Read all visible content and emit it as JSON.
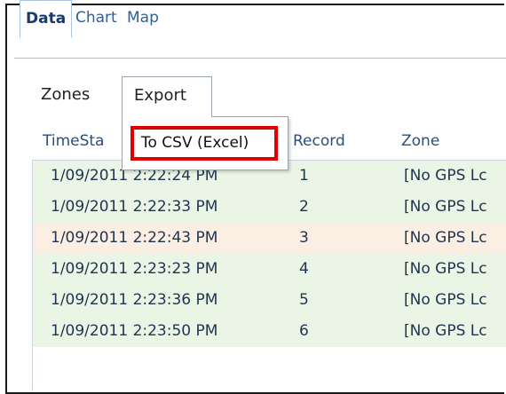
{
  "tabs": [
    {
      "label": "Data",
      "active": true
    },
    {
      "label": "Chart",
      "active": false
    },
    {
      "label": "Map",
      "active": false
    }
  ],
  "toolbar": {
    "zones_label": "Zones",
    "export_label": "Export",
    "export_menu_item": "To CSV (Excel)"
  },
  "grid": {
    "columns": [
      "TimeSta",
      "Record",
      "Zone"
    ],
    "rows": [
      {
        "time": "1/09/2011 2:22:24 PM",
        "record": "1",
        "zone": "[No GPS Lc",
        "bg": "#eaf5e6"
      },
      {
        "time": "1/09/2011 2:22:33 PM",
        "record": "2",
        "zone": "[No GPS Lc",
        "bg": "#eaf5e6"
      },
      {
        "time": "1/09/2011 2:22:43 PM",
        "record": "3",
        "zone": "[No GPS Lc",
        "bg": "#fbeee2"
      },
      {
        "time": "1/09/2011 2:23:23 PM",
        "record": "4",
        "zone": "[No GPS Lc",
        "bg": "#eaf5e6"
      },
      {
        "time": "1/09/2011 2:23:36 PM",
        "record": "5",
        "zone": "[No GPS Lc",
        "bg": "#eaf5e6"
      },
      {
        "time": "1/09/2011 2:23:50 PM",
        "record": "6",
        "zone": "[No GPS Lc",
        "bg": "#eaf5e6"
      }
    ]
  },
  "colors": {
    "highlight_border": "#e00000",
    "tab_text": "#2b5fa0",
    "row_green": "#eaf5e6",
    "row_orange": "#fbeee2"
  }
}
